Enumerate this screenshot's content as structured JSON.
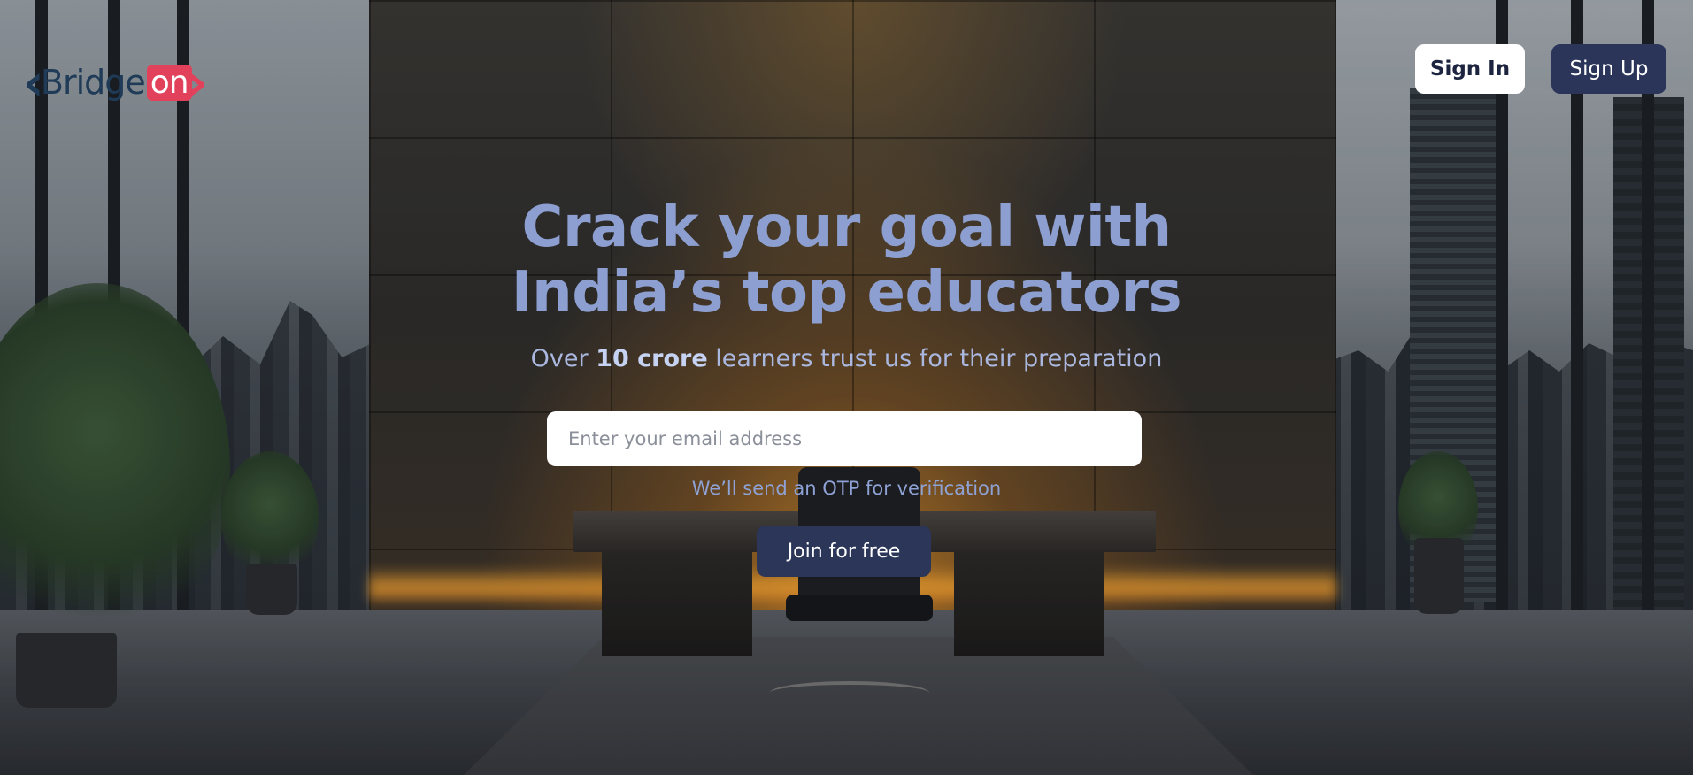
{
  "brand": {
    "logo_text": "Bridge",
    "logo_accent": "on",
    "primary_color": "#1f3b57",
    "accent_color": "#e2415b"
  },
  "header": {
    "sign_in_label": "Sign In",
    "sign_up_label": "Sign Up"
  },
  "hero": {
    "title_line1": "Crack your goal with",
    "title_line2": "India’s top educators",
    "subtitle_prefix": "Over ",
    "subtitle_bold": "10 crore",
    "subtitle_suffix": " learners trust us for their preparation",
    "email_placeholder": "Enter your email address",
    "email_value": "",
    "otp_note": "We’ll send an OTP for verification",
    "join_label": "Join for free"
  },
  "icons": {
    "logo_left_chevron": "chevron-left-icon",
    "logo_right_chevron": "chevron-right-icon"
  }
}
